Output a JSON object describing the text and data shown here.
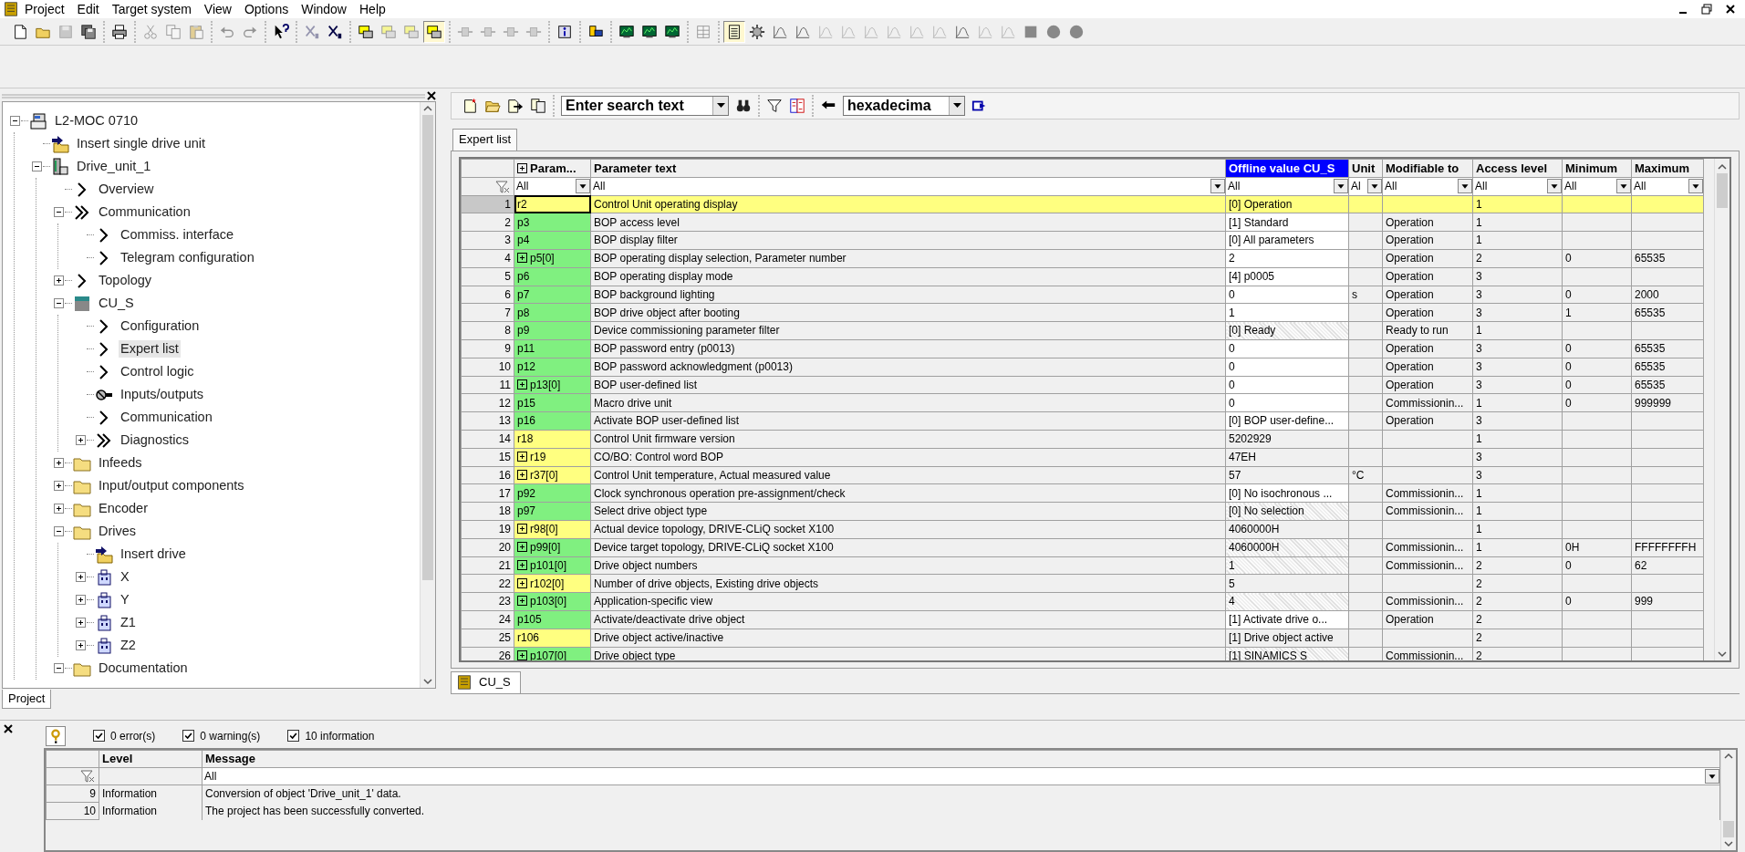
{
  "menu": [
    "Project",
    "Edit",
    "Target system",
    "View",
    "Options",
    "Window",
    "Help"
  ],
  "toolbar_groups": [
    [
      {
        "kind": "document",
        "pressed": false,
        "disabled": false
      },
      {
        "kind": "folder",
        "pressed": false,
        "disabled": false
      },
      {
        "kind": "disk",
        "pressed": false,
        "disabled": true
      },
      {
        "kind": "diskstack",
        "pressed": false,
        "disabled": false
      }
    ],
    [
      {
        "kind": "printer",
        "pressed": false,
        "disabled": false
      }
    ],
    [
      {
        "kind": "scissors",
        "pressed": false,
        "disabled": true
      },
      {
        "kind": "copy",
        "pressed": false,
        "disabled": true
      },
      {
        "kind": "paste",
        "pressed": false,
        "disabled": true
      }
    ],
    [
      {
        "kind": "undo",
        "pressed": false,
        "disabled": true
      },
      {
        "kind": "redo",
        "pressed": false,
        "disabled": true
      }
    ],
    [
      {
        "kind": "help",
        "pressed": false,
        "disabled": false
      }
    ],
    [
      {
        "kind": "cross",
        "pressed": false,
        "disabled": true
      },
      {
        "kind": "cross",
        "pressed": false,
        "disabled": false
      }
    ],
    [
      {
        "kind": "module",
        "pressed": false,
        "disabled": false
      },
      {
        "kind": "module",
        "pressed": false,
        "disabled": true
      },
      {
        "kind": "module",
        "pressed": false,
        "disabled": true
      },
      {
        "kind": "module",
        "pressed": true,
        "disabled": false
      }
    ],
    [
      {
        "kind": "connector",
        "pressed": false,
        "disabled": true
      },
      {
        "kind": "connector",
        "pressed": false,
        "disabled": true
      },
      {
        "kind": "connector",
        "pressed": false,
        "disabled": true
      },
      {
        "kind": "connector",
        "pressed": false,
        "disabled": true
      }
    ],
    [
      {
        "kind": "info",
        "pressed": false,
        "disabled": false
      }
    ],
    [
      {
        "kind": "device",
        "pressed": false,
        "disabled": false
      }
    ],
    [
      {
        "kind": "monitor",
        "pressed": false,
        "disabled": false
      },
      {
        "kind": "monitor",
        "pressed": false,
        "disabled": false
      },
      {
        "kind": "monitor",
        "pressed": false,
        "disabled": false
      }
    ],
    [
      {
        "kind": "grid",
        "pressed": false,
        "disabled": true
      }
    ],
    [
      {
        "kind": "table",
        "pressed": true,
        "disabled": false
      },
      {
        "kind": "gear",
        "pressed": false,
        "disabled": false
      },
      {
        "kind": "curve",
        "pressed": false,
        "disabled": false
      },
      {
        "kind": "curve",
        "pressed": false,
        "disabled": false
      },
      {
        "kind": "curve",
        "pressed": false,
        "disabled": true
      },
      {
        "kind": "curve",
        "pressed": false,
        "disabled": true
      },
      {
        "kind": "curve",
        "pressed": false,
        "disabled": true
      },
      {
        "kind": "curve",
        "pressed": false,
        "disabled": true
      },
      {
        "kind": "curve",
        "pressed": false,
        "disabled": true
      },
      {
        "kind": "curve",
        "pressed": false,
        "disabled": true
      },
      {
        "kind": "curve",
        "pressed": false,
        "disabled": false
      },
      {
        "kind": "curve",
        "pressed": false,
        "disabled": true
      },
      {
        "kind": "curve",
        "pressed": false,
        "disabled": true
      },
      {
        "kind": "square",
        "pressed": false,
        "disabled": false
      },
      {
        "kind": "circle",
        "pressed": false,
        "disabled": false
      },
      {
        "kind": "circle",
        "pressed": false,
        "disabled": false
      }
    ]
  ],
  "tree": [
    {
      "label": "L2-MOC 0710",
      "kind": "project",
      "expanded": true,
      "selected": false,
      "children": [
        {
          "label": "Insert single drive unit",
          "kind": "insert",
          "selected": false
        },
        {
          "label": "Drive_unit_1",
          "kind": "drive-unit",
          "expanded": true,
          "selected": false,
          "children": [
            {
              "label": "Overview",
              "kind": "arrow",
              "selected": false
            },
            {
              "label": "Communication",
              "kind": "double-arrow",
              "expanded": true,
              "selected": false,
              "children": [
                {
                  "label": "Commiss. interface",
                  "kind": "arrow",
                  "selected": false
                },
                {
                  "label": "Telegram configuration",
                  "kind": "arrow",
                  "selected": false
                }
              ]
            },
            {
              "label": "Topology",
              "kind": "arrow",
              "expanded": false,
              "selected": false
            },
            {
              "label": "CU_S",
              "kind": "cu",
              "expanded": true,
              "selected": false,
              "children": [
                {
                  "label": "Configuration",
                  "kind": "arrow",
                  "selected": false
                },
                {
                  "label": "Expert list",
                  "kind": "arrow",
                  "selected": true
                },
                {
                  "label": "Control logic",
                  "kind": "arrow",
                  "selected": false
                },
                {
                  "label": "Inputs/outputs",
                  "kind": "io",
                  "selected": false
                },
                {
                  "label": "Communication",
                  "kind": "arrow",
                  "selected": false
                },
                {
                  "label": "Diagnostics",
                  "kind": "double-arrow",
                  "expanded": false,
                  "selected": false
                }
              ]
            },
            {
              "label": "Infeeds",
              "kind": "folder",
              "expanded": false,
              "selected": false
            },
            {
              "label": "Input/output components",
              "kind": "folder",
              "expanded": false,
              "selected": false
            },
            {
              "label": "Encoder",
              "kind": "folder",
              "expanded": false,
              "selected": false
            },
            {
              "label": "Drives",
              "kind": "folder",
              "expanded": true,
              "selected": false,
              "children": [
                {
                  "label": "Insert drive",
                  "kind": "insert",
                  "selected": false
                },
                {
                  "label": "X",
                  "kind": "axis",
                  "expanded": false,
                  "selected": false
                },
                {
                  "label": "Y",
                  "kind": "axis",
                  "expanded": false,
                  "selected": false
                },
                {
                  "label": "Z1",
                  "kind": "axis",
                  "expanded": false,
                  "selected": false
                },
                {
                  "label": "Z2",
                  "kind": "axis",
                  "expanded": false,
                  "selected": false
                }
              ]
            },
            {
              "label": "Documentation",
              "kind": "folder",
              "expanded": true,
              "selected": false
            }
          ]
        }
      ]
    }
  ],
  "left_tabs": [
    {
      "label": "Project",
      "selected": true
    }
  ],
  "search": {
    "placeholder": "Enter search text"
  },
  "number_format": {
    "value": "hexadecima"
  },
  "view_tabs": [
    {
      "label": "Expert list",
      "selected": true
    }
  ],
  "columns": [
    {
      "label": "Param...",
      "expand_all": true,
      "selected": false
    },
    {
      "label": "Parameter text",
      "selected": false
    },
    {
      "label": "Offline value CU_S",
      "selected": true
    },
    {
      "label": "Unit",
      "selected": false
    },
    {
      "label": "Modifiable to",
      "selected": false
    },
    {
      "label": "Access level",
      "selected": false
    },
    {
      "label": "Minimum",
      "selected": false
    },
    {
      "label": "Maximum",
      "selected": false
    }
  ],
  "filters": [
    "All",
    "All",
    "All",
    "Al",
    "All",
    "All",
    "All",
    "All"
  ],
  "rows": [
    {
      "n": "1",
      "param": "r2",
      "color": "#ffff80",
      "expandable": false,
      "text": "Control Unit operating display",
      "value": "[0] Operation",
      "kind": "readonly",
      "access": "1",
      "selected": true
    },
    {
      "n": "2",
      "param": "p3",
      "color": "#80f080",
      "expandable": false,
      "text": "BOP access level",
      "value": "[1] Standard",
      "kind": "editable",
      "modifiable": "Operation",
      "access": "1",
      "selected": false
    },
    {
      "n": "3",
      "param": "p4",
      "color": "#80f080",
      "expandable": false,
      "text": "BOP display filter",
      "value": "[0] All parameters",
      "kind": "editable",
      "modifiable": "Operation",
      "access": "1",
      "selected": false
    },
    {
      "n": "4",
      "param": "p5[0]",
      "color": "#80f080",
      "expandable": true,
      "text": "BOP operating display selection, Parameter number",
      "value": "2",
      "kind": "editable",
      "modifiable": "Operation",
      "access": "2",
      "min": "0",
      "max": "65535",
      "selected": false
    },
    {
      "n": "5",
      "param": "p6",
      "color": "#80f080",
      "expandable": false,
      "text": "BOP operating display mode",
      "value": "[4] p0005",
      "kind": "editable",
      "modifiable": "Operation",
      "access": "3",
      "selected": false
    },
    {
      "n": "6",
      "param": "p7",
      "color": "#80f080",
      "expandable": false,
      "text": "BOP background lighting",
      "value": "0",
      "kind": "editable",
      "unit": "s",
      "modifiable": "Operation",
      "access": "3",
      "min": "0",
      "max": "2000",
      "selected": false
    },
    {
      "n": "7",
      "param": "p8",
      "color": "#80f080",
      "expandable": false,
      "text": "BOP drive object after booting",
      "value": "1",
      "kind": "editable",
      "modifiable": "Operation",
      "access": "3",
      "min": "1",
      "max": "65535",
      "selected": false
    },
    {
      "n": "8",
      "param": "p9",
      "color": "#80f080",
      "expandable": false,
      "text": "Device commissioning parameter filter",
      "value": "[0] Ready",
      "kind": "hatched",
      "modifiable": "Ready to run",
      "access": "1",
      "selected": false
    },
    {
      "n": "9",
      "param": "p11",
      "color": "#80f080",
      "expandable": false,
      "text": "BOP password entry (p0013)",
      "value": "0",
      "kind": "editable",
      "modifiable": "Operation",
      "access": "3",
      "min": "0",
      "max": "65535",
      "selected": false
    },
    {
      "n": "10",
      "param": "p12",
      "color": "#80f080",
      "expandable": false,
      "text": "BOP password acknowledgment (p0013)",
      "value": "0",
      "kind": "editable",
      "modifiable": "Operation",
      "access": "3",
      "min": "0",
      "max": "65535",
      "selected": false
    },
    {
      "n": "11",
      "param": "p13[0]",
      "color": "#80f080",
      "expandable": true,
      "text": "BOP user-defined list",
      "value": "0",
      "kind": "editable",
      "modifiable": "Operation",
      "access": "3",
      "min": "0",
      "max": "65535",
      "selected": false
    },
    {
      "n": "12",
      "param": "p15",
      "color": "#80f080",
      "expandable": false,
      "text": "Macro drive unit",
      "value": "0",
      "kind": "editable",
      "modifiable": "Commissionin...",
      "access": "1",
      "min": "0",
      "max": "999999",
      "selected": false
    },
    {
      "n": "13",
      "param": "p16",
      "color": "#80f080",
      "expandable": false,
      "text": "Activate BOP user-defined list",
      "value": "[0] BOP user-define...",
      "kind": "editable",
      "modifiable": "Operation",
      "access": "3",
      "selected": false
    },
    {
      "n": "14",
      "param": "r18",
      "color": "#ffff80",
      "expandable": false,
      "text": "Control Unit firmware version",
      "value": "5202929",
      "kind": "readonly",
      "access": "1",
      "selected": false
    },
    {
      "n": "15",
      "param": "r19",
      "color": "#ffff80",
      "expandable": true,
      "text": "CO/BO: Control word BOP",
      "value": "47EH",
      "kind": "readonly",
      "access": "3",
      "selected": false
    },
    {
      "n": "16",
      "param": "r37[0]",
      "color": "#ffff80",
      "expandable": true,
      "text": "Control Unit temperature, Actual measured value",
      "value": "57",
      "kind": "readonly",
      "unit": "°C",
      "access": "3",
      "selected": false
    },
    {
      "n": "17",
      "param": "p92",
      "color": "#80f080",
      "expandable": false,
      "text": "Clock synchronous operation pre-assignment/check",
      "value": "[0] No isochronous ...",
      "kind": "editable",
      "modifiable": "Commissionin...",
      "access": "1",
      "selected": false
    },
    {
      "n": "18",
      "param": "p97",
      "color": "#80f080",
      "expandable": false,
      "text": "Select drive object type",
      "value": "[0] No selection",
      "kind": "hatched",
      "modifiable": "Commissionin...",
      "access": "1",
      "selected": false
    },
    {
      "n": "19",
      "param": "r98[0]",
      "color": "#ffff80",
      "expandable": true,
      "text": "Actual device topology, DRIVE-CLiQ socket X100",
      "value": "4060000H",
      "kind": "readonly",
      "access": "1",
      "selected": false
    },
    {
      "n": "20",
      "param": "p99[0]",
      "color": "#80f080",
      "expandable": true,
      "text": "Device target topology, DRIVE-CLiQ socket X100",
      "value": "4060000H",
      "kind": "hatched",
      "modifiable": "Commissionin...",
      "access": "1",
      "min": "0H",
      "max": "FFFFFFFFH",
      "selected": false
    },
    {
      "n": "21",
      "param": "p101[0]",
      "color": "#80f080",
      "expandable": true,
      "text": "Drive object numbers",
      "value": "1",
      "kind": "hatched",
      "modifiable": "Commissionin...",
      "access": "2",
      "min": "0",
      "max": "62",
      "selected": false
    },
    {
      "n": "22",
      "param": "r102[0]",
      "color": "#ffff80",
      "expandable": true,
      "text": "Number of drive objects, Existing drive objects",
      "value": "5",
      "kind": "readonly",
      "access": "2",
      "selected": false
    },
    {
      "n": "23",
      "param": "p103[0]",
      "color": "#80f080",
      "expandable": true,
      "text": "Application-specific view",
      "value": "4",
      "kind": "hatched",
      "modifiable": "Commissionin...",
      "access": "2",
      "min": "0",
      "max": "999",
      "selected": false
    },
    {
      "n": "24",
      "param": "p105",
      "color": "#80f080",
      "expandable": false,
      "text": "Activate/deactivate drive object",
      "value": "[1] Activate drive o...",
      "kind": "editable",
      "modifiable": "Operation",
      "access": "2",
      "selected": false
    },
    {
      "n": "25",
      "param": "r106",
      "color": "#ffff80",
      "expandable": false,
      "text": "Drive object active/inactive",
      "value": "[1] Drive object active",
      "kind": "readonly",
      "access": "2",
      "selected": false
    },
    {
      "n": "26",
      "param": "p107[0]",
      "color": "#80f080",
      "expandable": true,
      "text": "Drive object type",
      "value": "[1] SINAMICS S",
      "kind": "hatched",
      "modifiable": "Commissionin...",
      "access": "2",
      "selected": false
    }
  ],
  "editor_tabs": [
    {
      "label": "CU_S",
      "selected": true
    }
  ],
  "alarm_filters": [
    {
      "label": "0 error(s)",
      "checked": true
    },
    {
      "label": "0 warning(s)",
      "checked": true
    },
    {
      "label": "10 information",
      "checked": true
    }
  ],
  "alarm_columns": [
    "Level",
    "Message"
  ],
  "alarm_filter": "All",
  "alarms": [
    {
      "n": "9",
      "level": "Information",
      "message": "Conversion of object 'Drive_unit_1' data."
    },
    {
      "n": "10",
      "level": "Information",
      "message": "The project has been successfully converted."
    }
  ]
}
